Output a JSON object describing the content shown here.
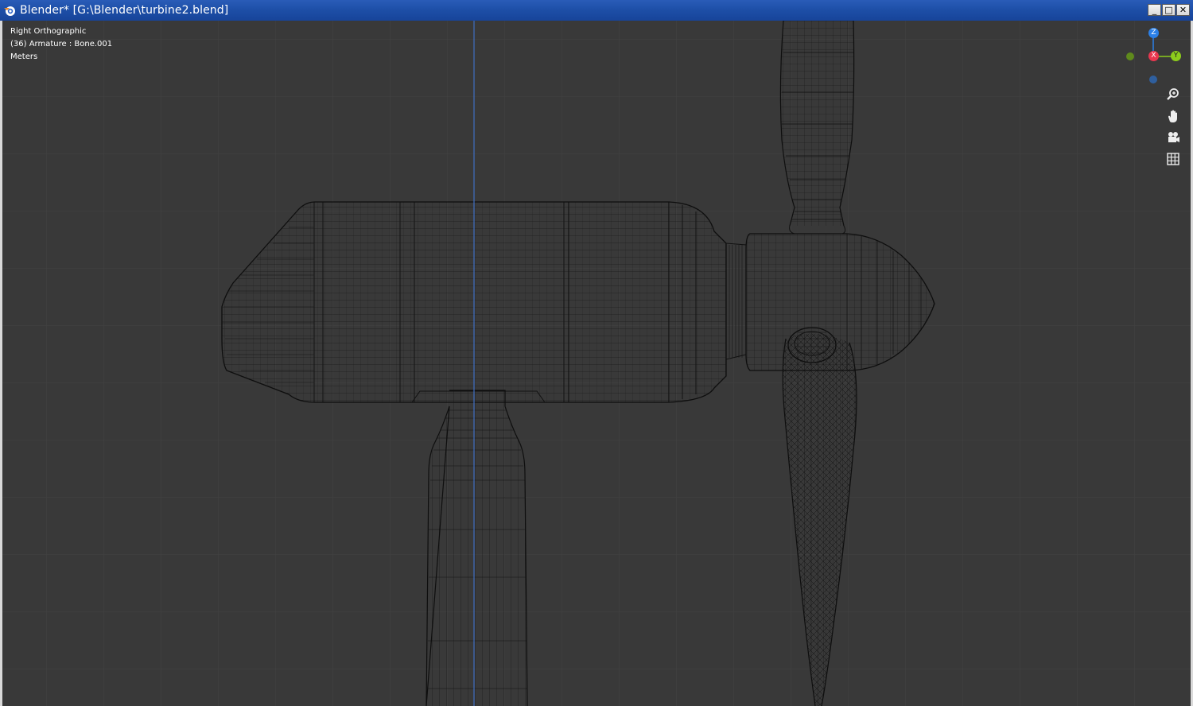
{
  "window": {
    "title": "Blender* [G:\\Blender\\turbine2.blend]",
    "controls": {
      "minimize": "_",
      "maximize": "□",
      "close": "✕"
    }
  },
  "viewport": {
    "view_name": "Right Orthographic",
    "object_info": "(36) Armature : Bone.001",
    "units": "Meters",
    "background_color": "#393939",
    "grid_color": "#454545",
    "wire_color": "#111111"
  },
  "gizmo": {
    "z_label": "Z",
    "x_label": "X",
    "y_label": "Y",
    "z_color": "#2b80e8",
    "x_color": "#e8374f",
    "y_color": "#8ccc1c"
  },
  "nav_icons": [
    "zoom-icon",
    "pan-hand-icon",
    "camera-icon",
    "ortho-grid-icon"
  ]
}
